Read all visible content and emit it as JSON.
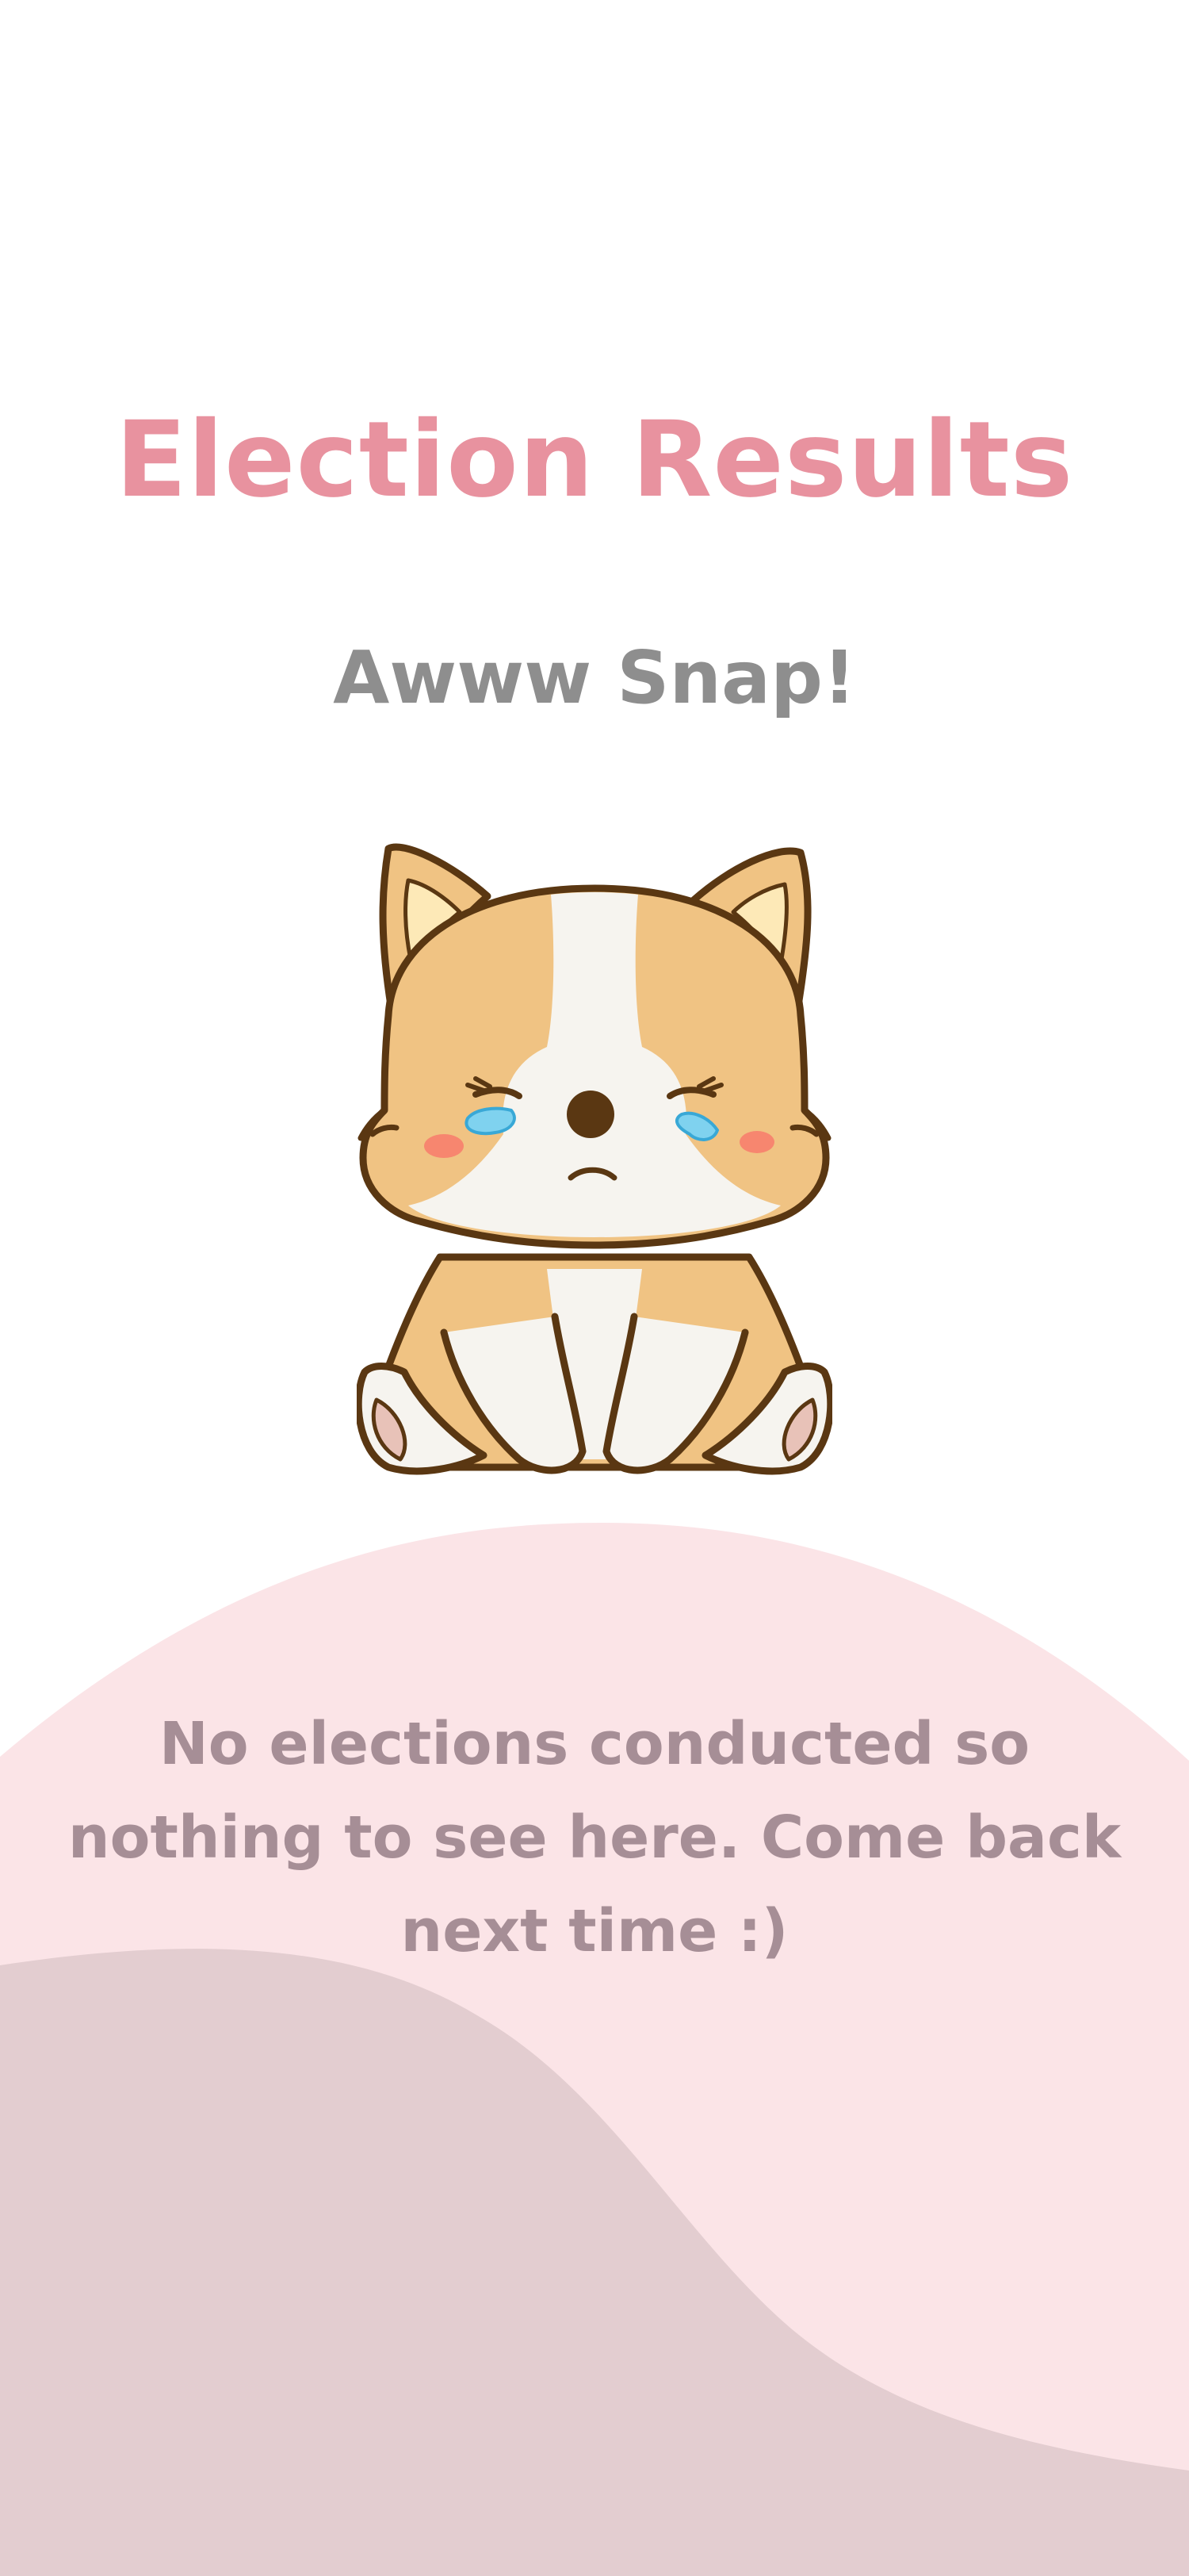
{
  "page": {
    "title": "Election Results",
    "subtitle": "Awww Snap!",
    "message": "No elections conducted so nothing to see here. Come back next time :)"
  },
  "icons": {
    "mascot": "crying-corgi-illustration"
  },
  "colors": {
    "title": "#e8929f",
    "subtitle": "#8e8e8e",
    "message": "#a68e96",
    "wave_light": "#fbe4e7",
    "wave_dark": "#e3cdd0",
    "background": "#ffffff"
  }
}
